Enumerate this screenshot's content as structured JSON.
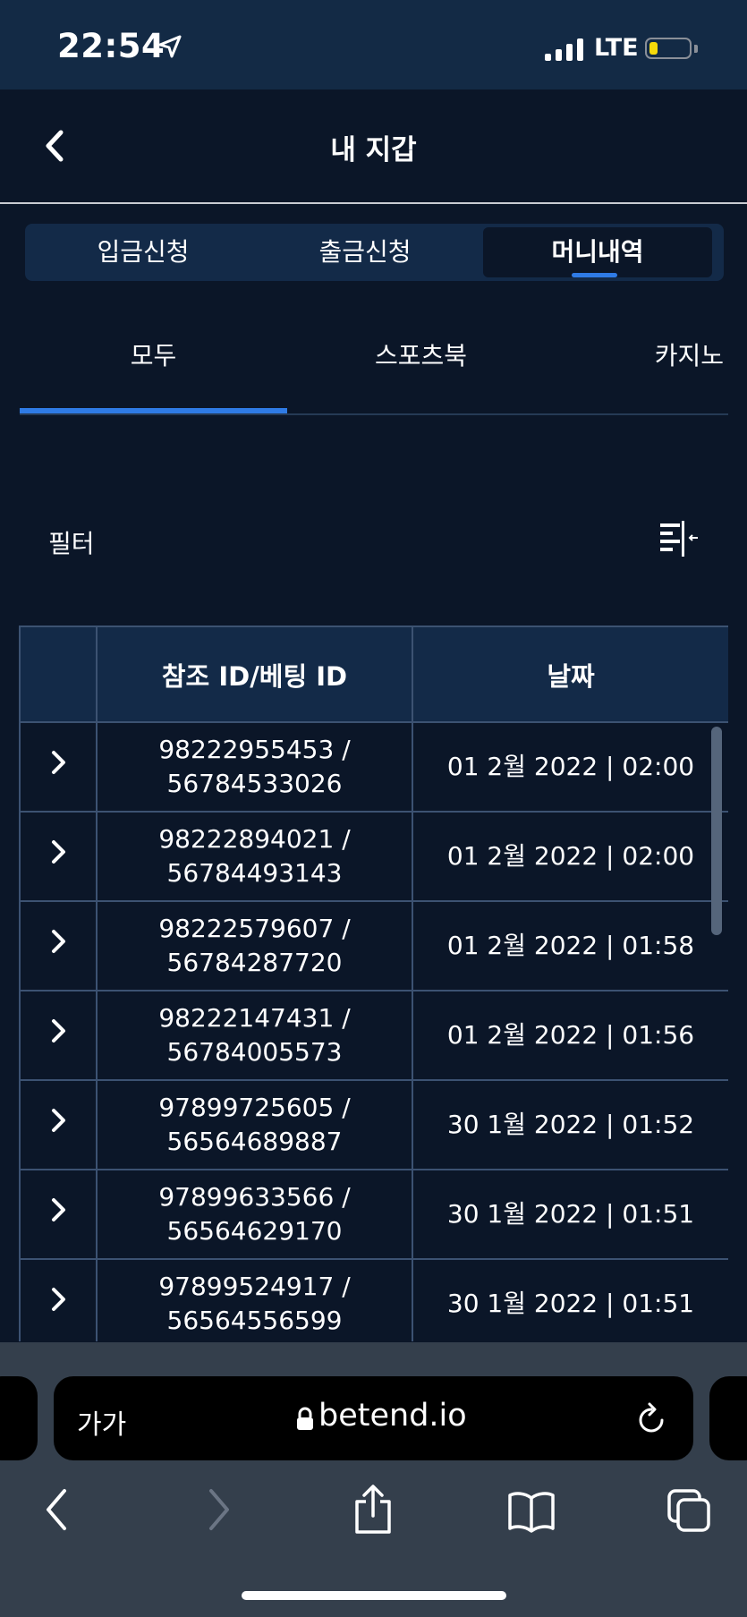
{
  "status_bar": {
    "time": "22:54",
    "network": "LTE"
  },
  "header": {
    "title": "내 지갑"
  },
  "segments": [
    {
      "label": "입금신청",
      "active": false
    },
    {
      "label": "출금신청",
      "active": false
    },
    {
      "label": "머니내역",
      "active": true
    }
  ],
  "sub_tabs": [
    {
      "label": "모두",
      "active": true
    },
    {
      "label": "스포츠북",
      "active": false
    },
    {
      "label": "카지노",
      "active": false
    }
  ],
  "filter": {
    "label": "필터"
  },
  "table": {
    "headers": [
      "",
      "참조 ID/베팅 ID",
      "날짜"
    ],
    "rows": [
      {
        "ref": "98222955453 /",
        "bet": "56784533026",
        "date": "01 2월 2022 | 02:00"
      },
      {
        "ref": "98222894021 /",
        "bet": "56784493143",
        "date": "01 2월 2022 | 02:00"
      },
      {
        "ref": "98222579607 /",
        "bet": "56784287720",
        "date": "01 2월 2022 | 01:58"
      },
      {
        "ref": "98222147431 /",
        "bet": "56784005573",
        "date": "01 2월 2022 | 01:56"
      },
      {
        "ref": "97899725605 /",
        "bet": "56564689887",
        "date": "30 1월 2022 | 01:52"
      },
      {
        "ref": "97899633566 /",
        "bet": "56564629170",
        "date": "30 1월 2022 | 01:51"
      },
      {
        "ref": "97899524917 /",
        "bet": "56564556599",
        "date": "30 1월 2022 | 01:51"
      }
    ]
  },
  "browser": {
    "text_size_label": "가가",
    "url": "betend.io"
  },
  "colors": {
    "background": "#0b1628",
    "accent": "#2f7be5",
    "panel": "#132a48",
    "border": "#3c5272"
  }
}
